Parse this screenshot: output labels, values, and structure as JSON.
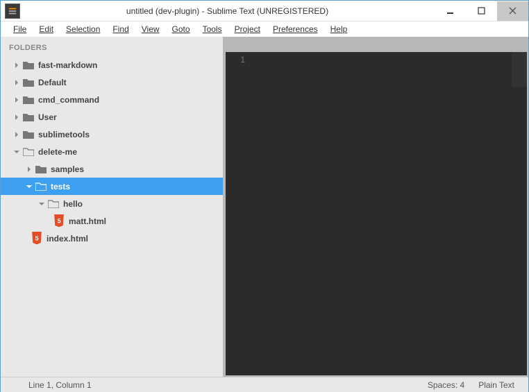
{
  "title": "untitled (dev-plugin) - Sublime Text (UNREGISTERED)",
  "menu": {
    "file": "File",
    "edit": "Edit",
    "selection": "Selection",
    "find": "Find",
    "view": "View",
    "goto": "Goto",
    "tools": "Tools",
    "project": "Project",
    "preferences": "Preferences",
    "help": "Help"
  },
  "sidebar": {
    "header": "FOLDERS",
    "items": {
      "fast_markdown": "fast-markdown",
      "default": "Default",
      "cmd_command": "cmd_command",
      "user": "User",
      "sublimetools": "sublimetools",
      "delete_me": "delete-me",
      "samples": "samples",
      "tests": "tests",
      "hello": "hello",
      "matt_html": "matt.html",
      "index_html": "index.html"
    }
  },
  "editor": {
    "line_number": "1"
  },
  "status": {
    "position": "Line 1, Column 1",
    "spaces": "Spaces: 4",
    "syntax": "Plain Text"
  }
}
